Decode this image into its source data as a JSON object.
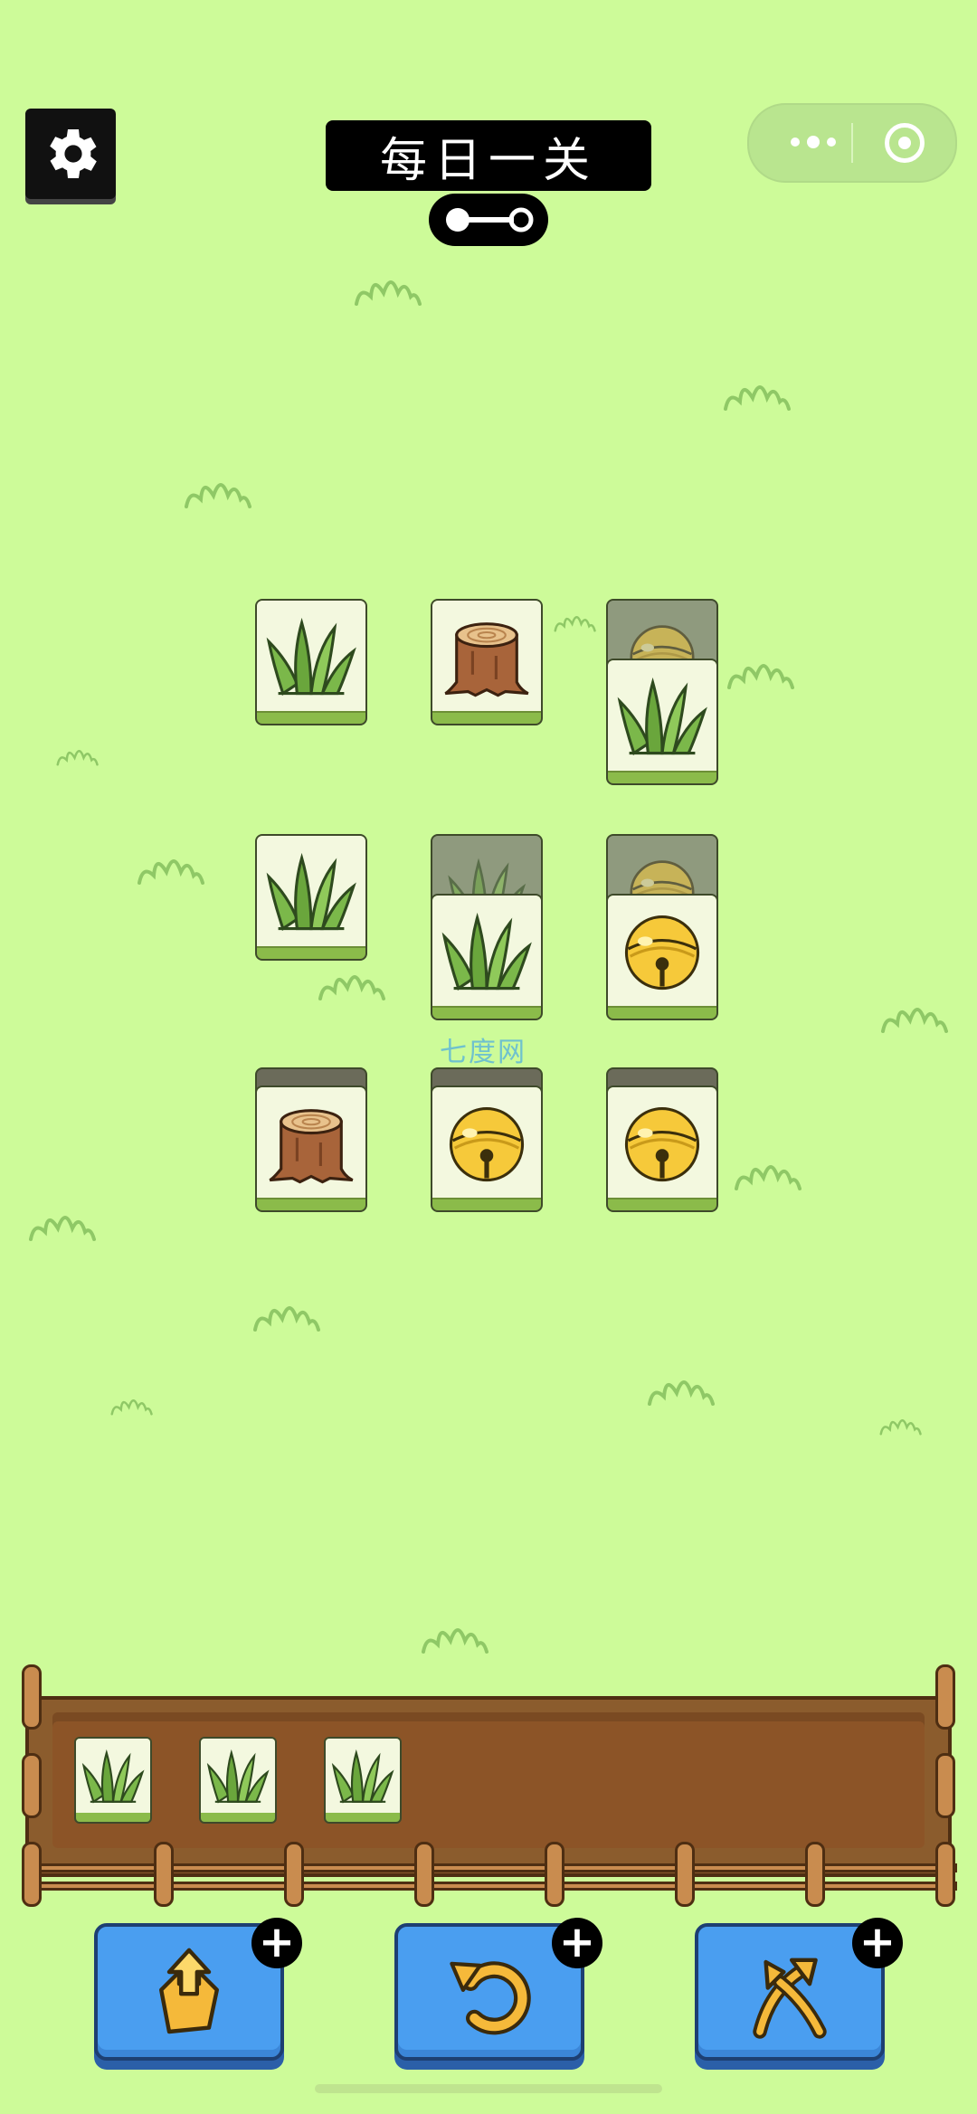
{
  "header": {
    "title": "每日一关",
    "settings_icon": "gear-icon",
    "key_icon": "key-icon",
    "capsule_more_icon": "more-dots-icon",
    "capsule_close_icon": "target-circle-icon"
  },
  "board": {
    "tiles": [
      {
        "row": 1,
        "col": 1,
        "icon": "grass",
        "state": "free"
      },
      {
        "row": 1,
        "col": 2,
        "icon": "stump",
        "state": "free"
      },
      {
        "row": 1,
        "col": 3,
        "icon": "bell",
        "state": "covered"
      },
      {
        "row": 1,
        "col": 3,
        "icon": "grass",
        "state": "free"
      },
      {
        "row": 2,
        "col": 1,
        "icon": "grass",
        "state": "free"
      },
      {
        "row": 2,
        "col": 2,
        "icon": "grass",
        "state": "covered"
      },
      {
        "row": 2,
        "col": 2,
        "icon": "grass",
        "state": "free"
      },
      {
        "row": 2,
        "col": 3,
        "icon": "bell",
        "state": "covered"
      },
      {
        "row": 2,
        "col": 3,
        "icon": "bell",
        "state": "free"
      },
      {
        "row": 3,
        "col": 1,
        "icon": "stump",
        "state": "free"
      },
      {
        "row": 3,
        "col": 2,
        "icon": "bell",
        "state": "free"
      },
      {
        "row": 3,
        "col": 3,
        "icon": "bell",
        "state": "free"
      }
    ]
  },
  "tray": {
    "slots": [
      "grass",
      "grass",
      "grass"
    ]
  },
  "powerups": [
    {
      "name": "move-out",
      "icon": "move-out-icon",
      "badge": "+"
    },
    {
      "name": "undo",
      "icon": "undo-icon",
      "badge": "+"
    },
    {
      "name": "shuffle",
      "icon": "shuffle-icon",
      "badge": "+"
    }
  ],
  "watermark": "七度网",
  "colors": {
    "background": "#cdfb99",
    "tile_face": "#f3f8df",
    "tile_base": "#8bbb4a",
    "tray_wood": "#8b5c2d",
    "button_blue": "#4a9ef0"
  }
}
